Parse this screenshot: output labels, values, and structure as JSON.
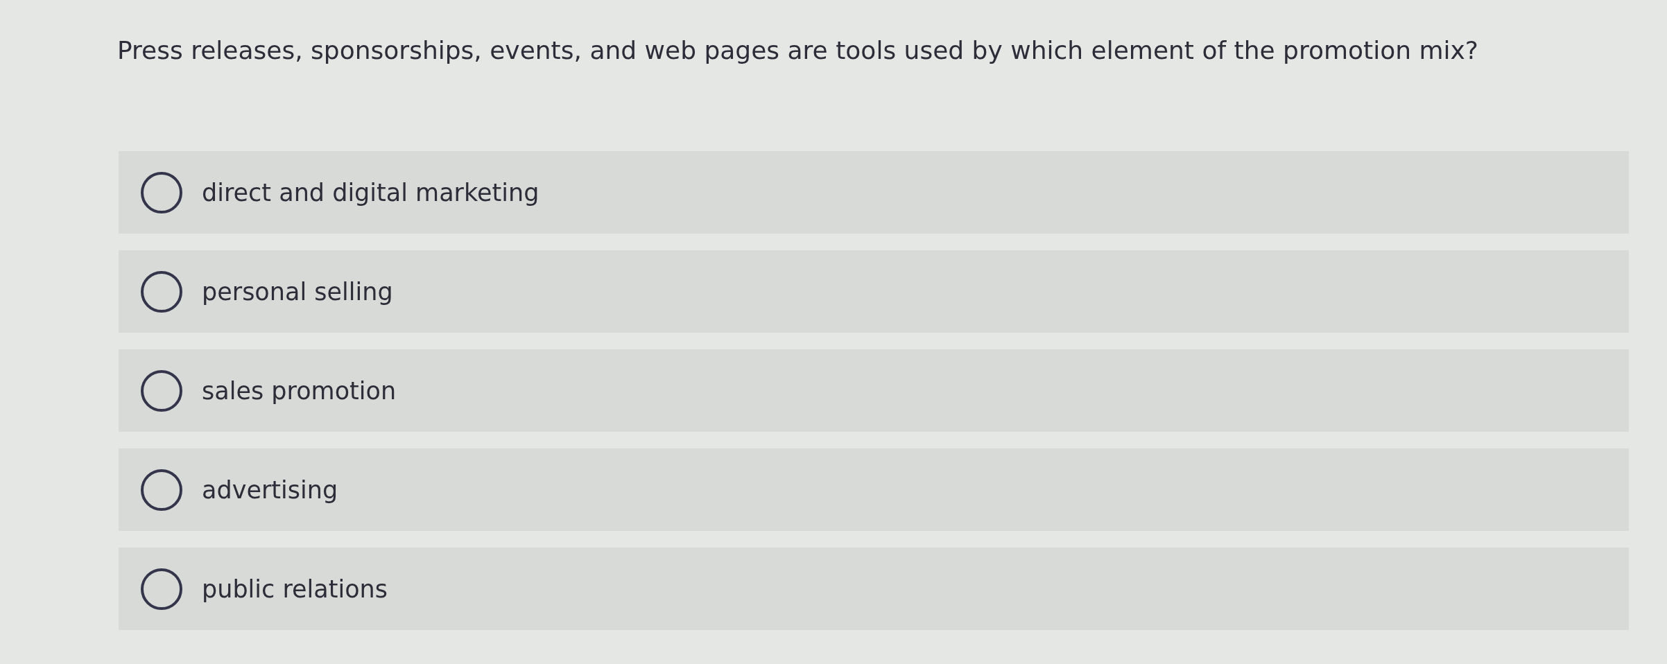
{
  "question": "Press releases, sponsorships, events, and web pages are tools used by which element of the promotion mix?",
  "options": [
    {
      "label": "direct and digital marketing",
      "selected": false
    },
    {
      "label": "personal selling",
      "selected": false
    },
    {
      "label": "sales promotion",
      "selected": false
    },
    {
      "label": "advertising",
      "selected": false
    },
    {
      "label": "public relations",
      "selected": false
    }
  ]
}
